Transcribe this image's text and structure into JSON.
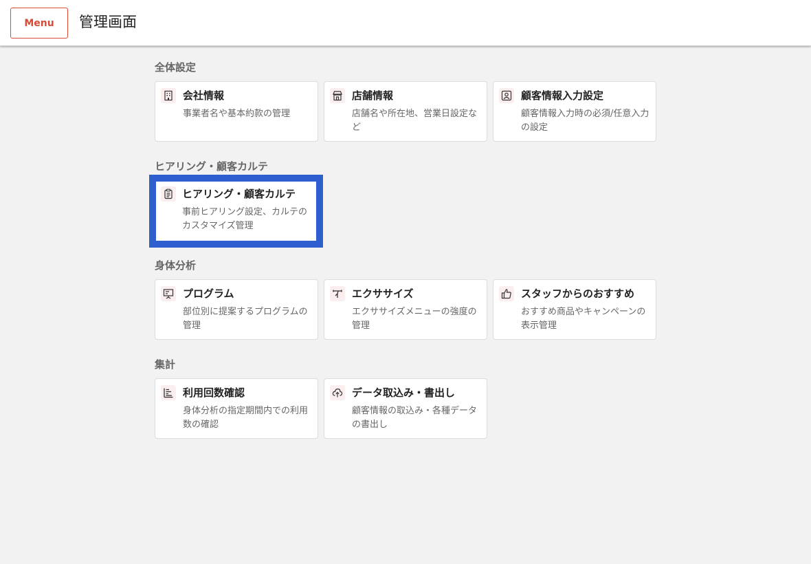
{
  "header": {
    "menu_label": "Menu",
    "title": "管理画面"
  },
  "colors": {
    "accent": "#d64a36",
    "selection": "#2f5fcf",
    "background": "#f2f2f2"
  },
  "sections": [
    {
      "title": "全体設定",
      "cards": [
        {
          "icon": "building-icon",
          "title": "会社情報",
          "desc": "事業者名や基本約款の管理"
        },
        {
          "icon": "store-icon",
          "title": "店舗情報",
          "desc": "店舗名や所在地、営業日設定など"
        },
        {
          "icon": "contact-card-icon",
          "title": "顧客情報入力設定",
          "desc": "顧客情報入力時の必須/任意入力の設定"
        }
      ]
    },
    {
      "title": "ヒアリング・顧客カルテ",
      "cards": [
        {
          "icon": "clipboard-icon",
          "title": "ヒアリング・顧客カルテ",
          "desc": "事前ヒアリング設定、カルテのカスタマイズ管理",
          "selected": true
        }
      ]
    },
    {
      "title": "身体分析",
      "cards": [
        {
          "icon": "presentation-icon",
          "title": "プログラム",
          "desc": "部位別に提案するプログラムの管理"
        },
        {
          "icon": "exercise-icon",
          "title": "エクササイズ",
          "desc": "エクササイズメニューの強度の管理"
        },
        {
          "icon": "thumbs-up-icon",
          "title": "スタッフからのおすすめ",
          "desc": "おすすめ商品やキャンペーンの表示管理"
        }
      ]
    },
    {
      "title": "集計",
      "cards": [
        {
          "icon": "bar-list-icon",
          "title": "利用回数確認",
          "desc": "身体分析の指定期間内での利用数の確認"
        },
        {
          "icon": "cloud-upload-icon",
          "title": "データ取込み・書出し",
          "desc": "顧客情報の取込み・各種データの書出し"
        }
      ]
    }
  ]
}
